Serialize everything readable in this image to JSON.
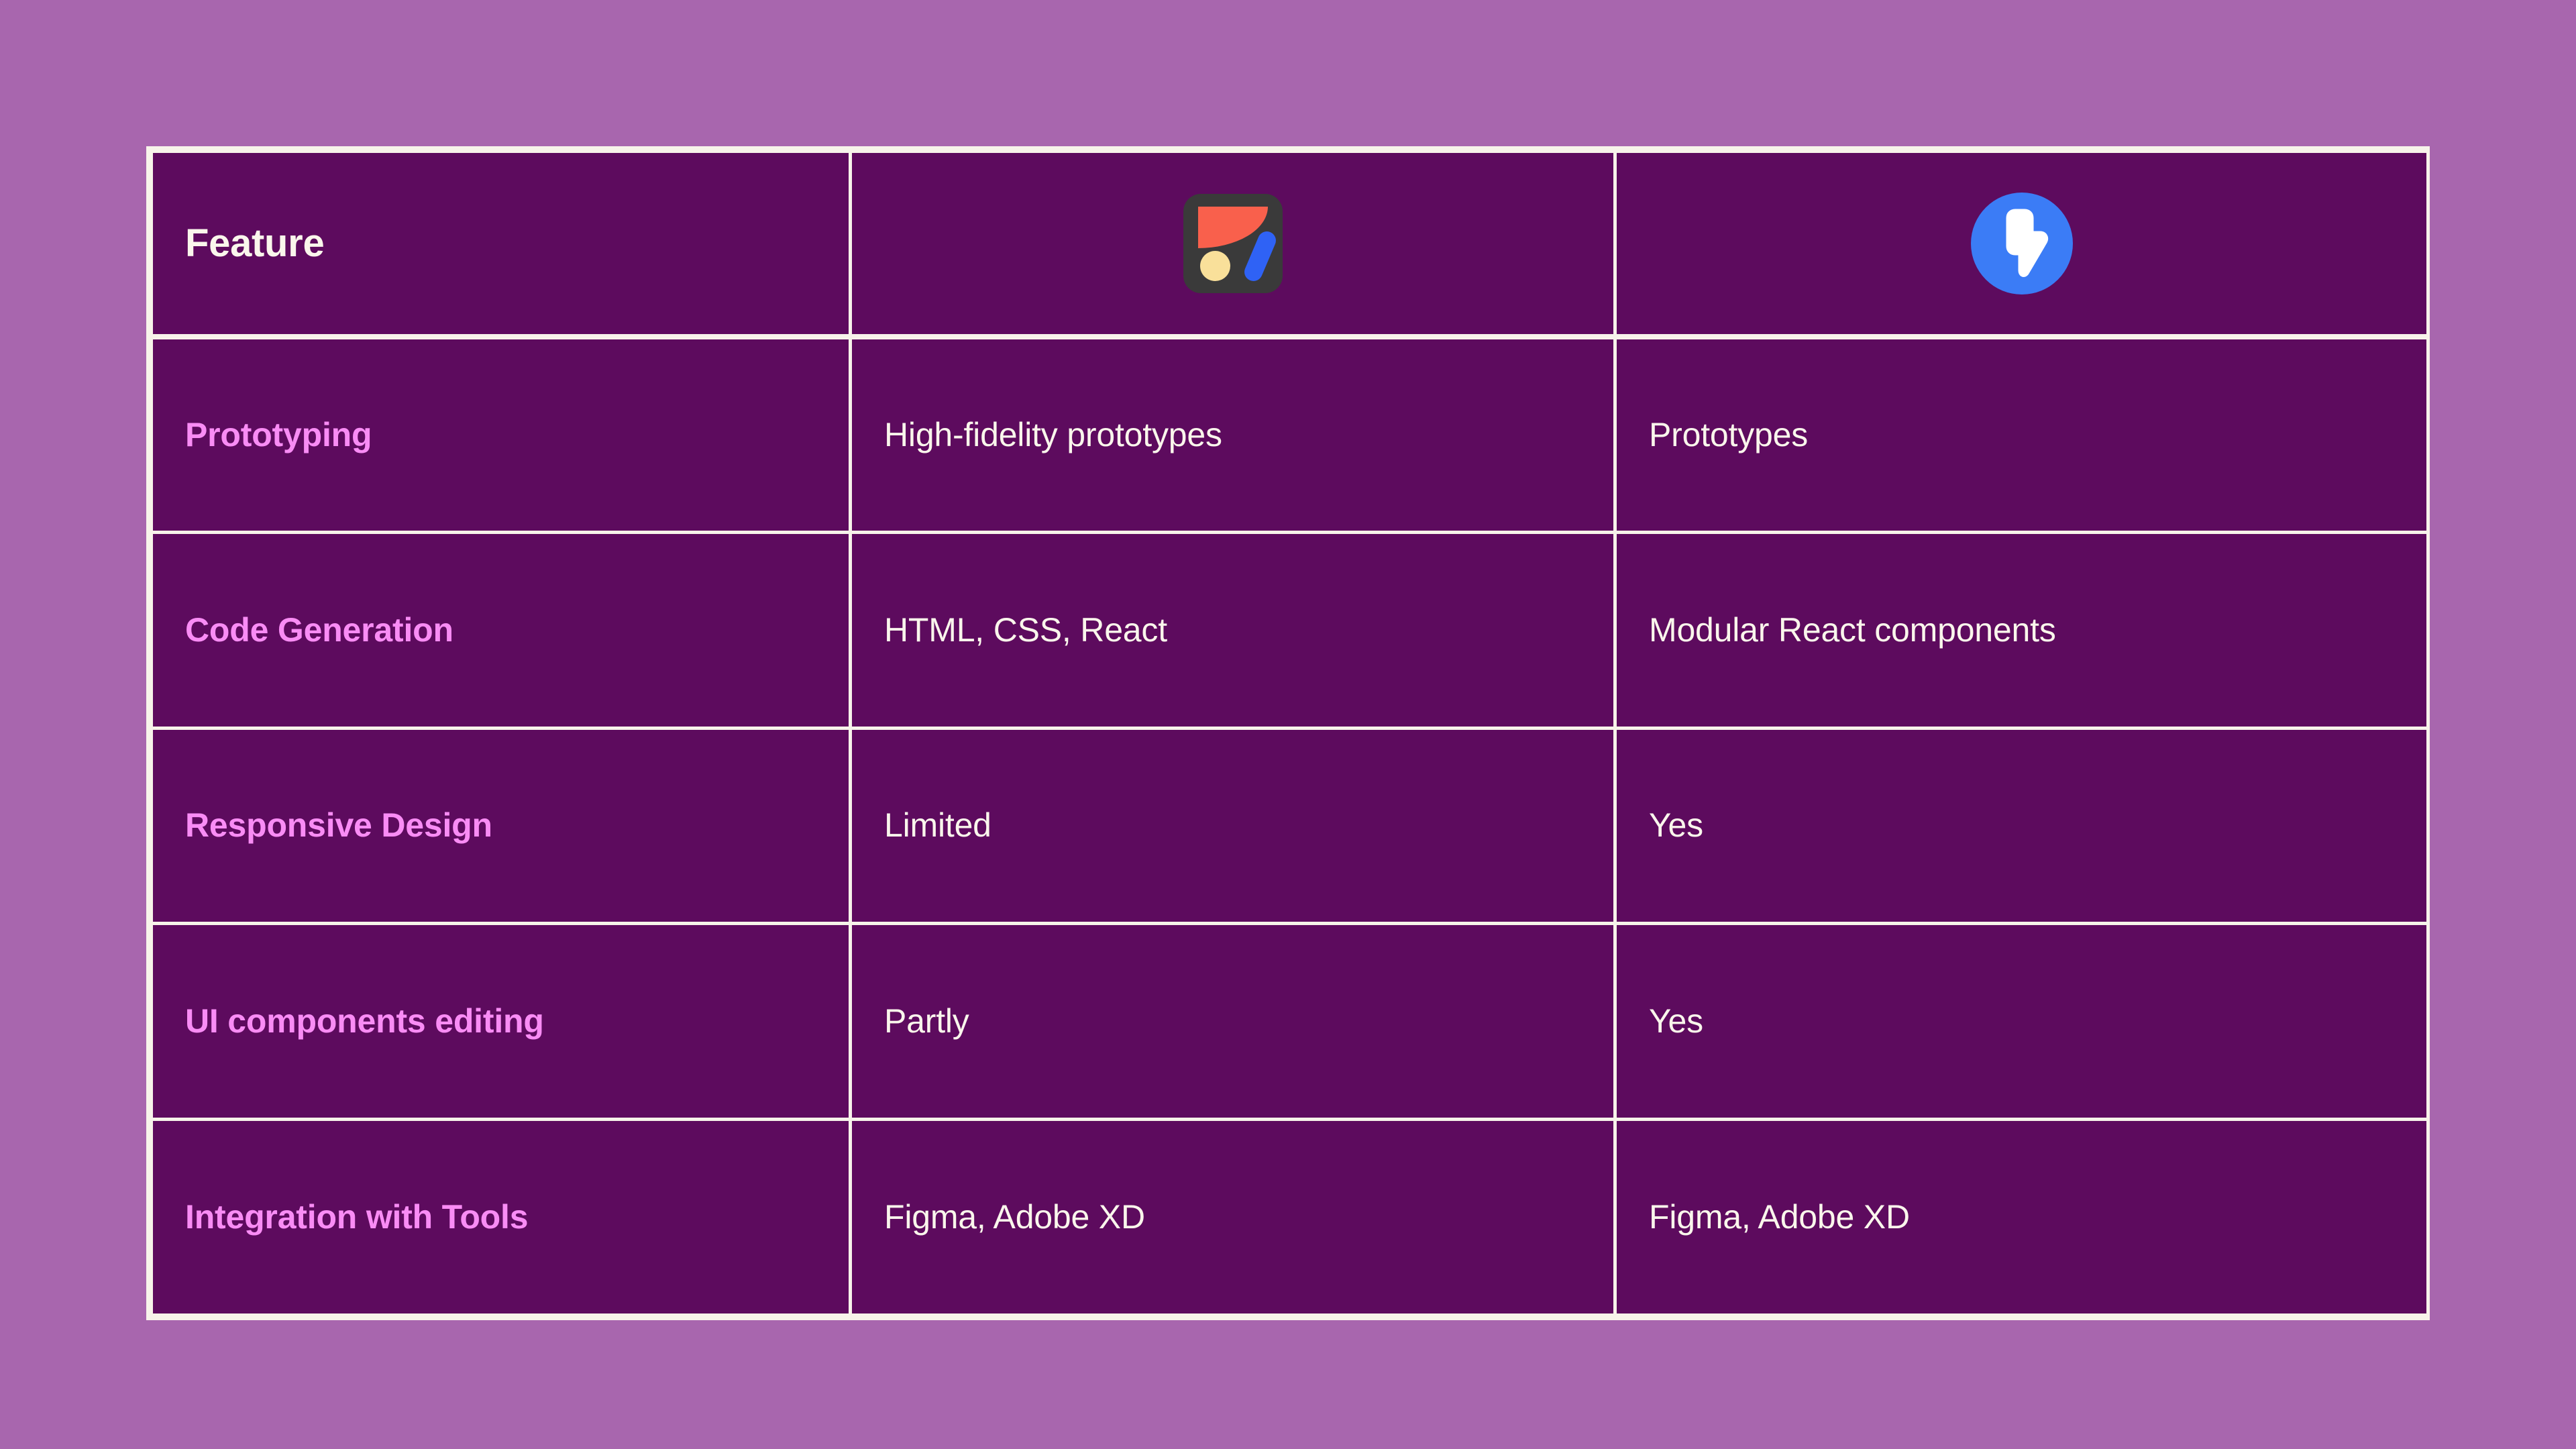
{
  "canvas": {
    "background_color": "#a866ae",
    "table_border_color": "#f7f3ea",
    "cell_background_color": "#5d0b5e",
    "feature_label_color": "#f98cf5",
    "value_text_color": "#faf6ec"
  },
  "table": {
    "header": {
      "feature_label": "Feature",
      "columns": [
        {
          "icon": "framer-logo-icon",
          "icon_colors": {
            "tile": "#3a3a3a",
            "flag": "#f9604c",
            "dot": "#f9e09a",
            "bar": "#2f62f5"
          }
        },
        {
          "icon": "blue-lightning-bolt-circle-icon",
          "icon_colors": {
            "circle": "#3b7cf6",
            "bolt": "#ffffff"
          }
        }
      ]
    },
    "rows": [
      {
        "feature": "Prototyping",
        "col_a": "High-fidelity prototypes",
        "col_b": "Prototypes"
      },
      {
        "feature": "Code Generation",
        "col_a": "HTML, CSS, React",
        "col_b": "Modular React components"
      },
      {
        "feature": "Responsive Design",
        "col_a": "Limited",
        "col_b": "Yes"
      },
      {
        "feature": "UI components editing",
        "col_a": "Partly",
        "col_b": "Yes"
      },
      {
        "feature": "Integration with Tools",
        "col_a": "Figma, Adobe XD",
        "col_b": "Figma, Adobe XD"
      }
    ]
  }
}
